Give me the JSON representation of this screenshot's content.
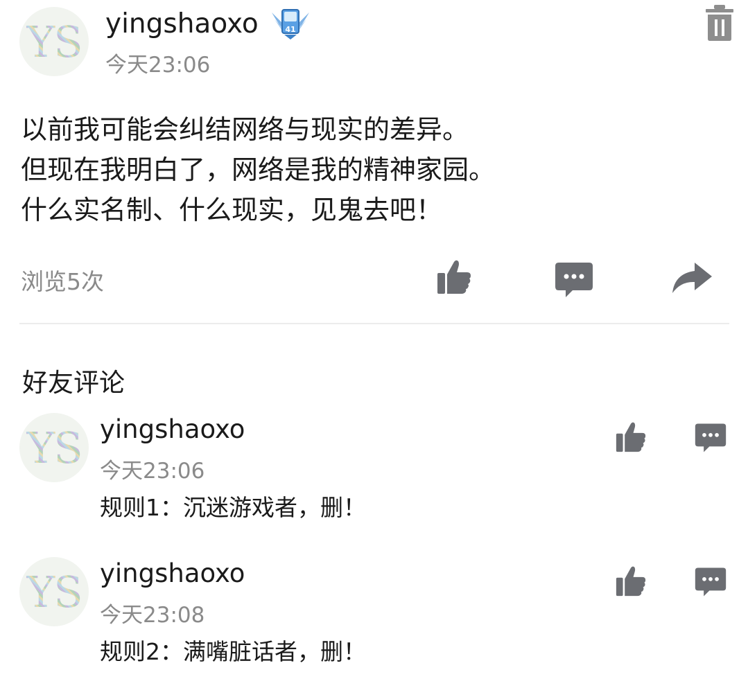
{
  "post": {
    "avatar_text": "YS",
    "username": "yingshaoxo",
    "badge_level": "41",
    "time": "今天23:06",
    "lines": [
      "以前我可能会纠结网络与现实的差异。",
      "但现在我明白了，网络是我的精神家园。",
      "什么实名制、什么现实，见鬼去吧！"
    ],
    "views": "浏览5次",
    "icons": {
      "delete": "trash-icon",
      "like": "thumbs-up-icon",
      "comment": "comment-icon",
      "share": "share-icon"
    }
  },
  "comments_section": {
    "title": "好友评论",
    "items": [
      {
        "avatar_text": "YS",
        "username": "yingshaoxo",
        "time": "今天23:06",
        "text": "规则1：沉迷游戏者，删！"
      },
      {
        "avatar_text": "YS",
        "username": "yingshaoxo",
        "time": "今天23:08",
        "text": "规则2：满嘴脏话者，删！"
      }
    ]
  },
  "colors": {
    "icon_gray": "#6b6d72",
    "secondary_text": "#8a8a8a",
    "badge_blue": "#4a90d9"
  }
}
